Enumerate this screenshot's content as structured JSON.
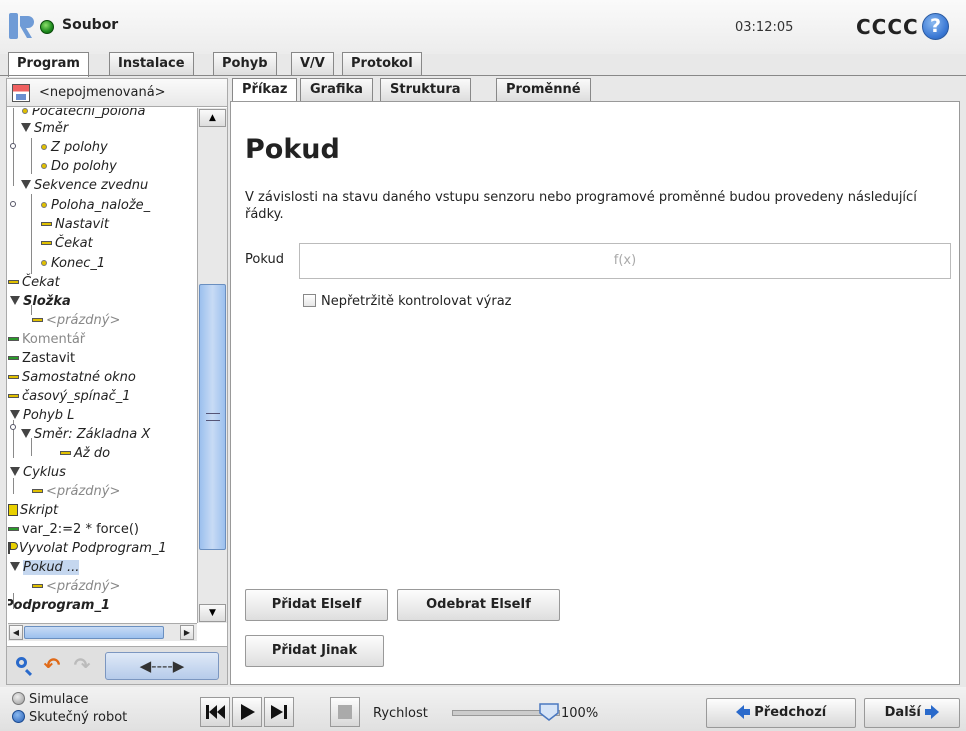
{
  "header": {
    "title": "Soubor",
    "time": "03:12:05",
    "robot_name": "CCCC",
    "help": "?"
  },
  "main_tabs": [
    "Program",
    "Instalace",
    "Pohyb",
    "V/V",
    "Protokol"
  ],
  "program": {
    "file_name": "<nepojmenovaná>"
  },
  "tree": {
    "items": [
      "Počáteční_poloha",
      "Směr",
      "Z polohy",
      "Do polohy",
      "Sekvence zvednu",
      "Poloha_nalože_",
      "Nastavit",
      "Čekat",
      "Konec_1",
      "Čekat",
      "Složka",
      "<prázdný>",
      "Komentář",
      "Zastavit",
      "Samostatné okno",
      "časový_spínač_1",
      "Pohyb L",
      "Směr: Základna X",
      "Až do",
      "Cyklus",
      "<prázdný>",
      "Skript",
      "var_2:=2 * force()",
      "Vyvolat Podprogram_1",
      "Pokud ...",
      "<prázdný>",
      "Podprogram_1"
    ]
  },
  "sub_tabs": [
    "Příkaz",
    "Grafika",
    "Struktura",
    "Proměnné"
  ],
  "command": {
    "heading": "Pokud",
    "description": "V závislosti na stavu daného vstupu senzoru nebo programové proměnné budou provedeny následující řádky.",
    "if_label": "Pokud",
    "expression_placeholder": "f(x)",
    "continuous_check_label": "Nepřetržitě kontrolovat výraz",
    "add_elseif": "Přidat ElseIf",
    "remove_elseif": "Odebrat ElseIf",
    "add_else": "Přidat Jinak"
  },
  "footer": {
    "simulation": "Simulace",
    "real_robot": "Skutečný robot",
    "speed_label": "Rychlost",
    "speed_value": "100%",
    "speed_fraction": 1.0,
    "prev": "Předchozí",
    "next": "Další"
  },
  "colors": {
    "accent_blue": "#2a6acb",
    "selection": "#c5d7ef",
    "status_green": "#1d8a1d"
  }
}
